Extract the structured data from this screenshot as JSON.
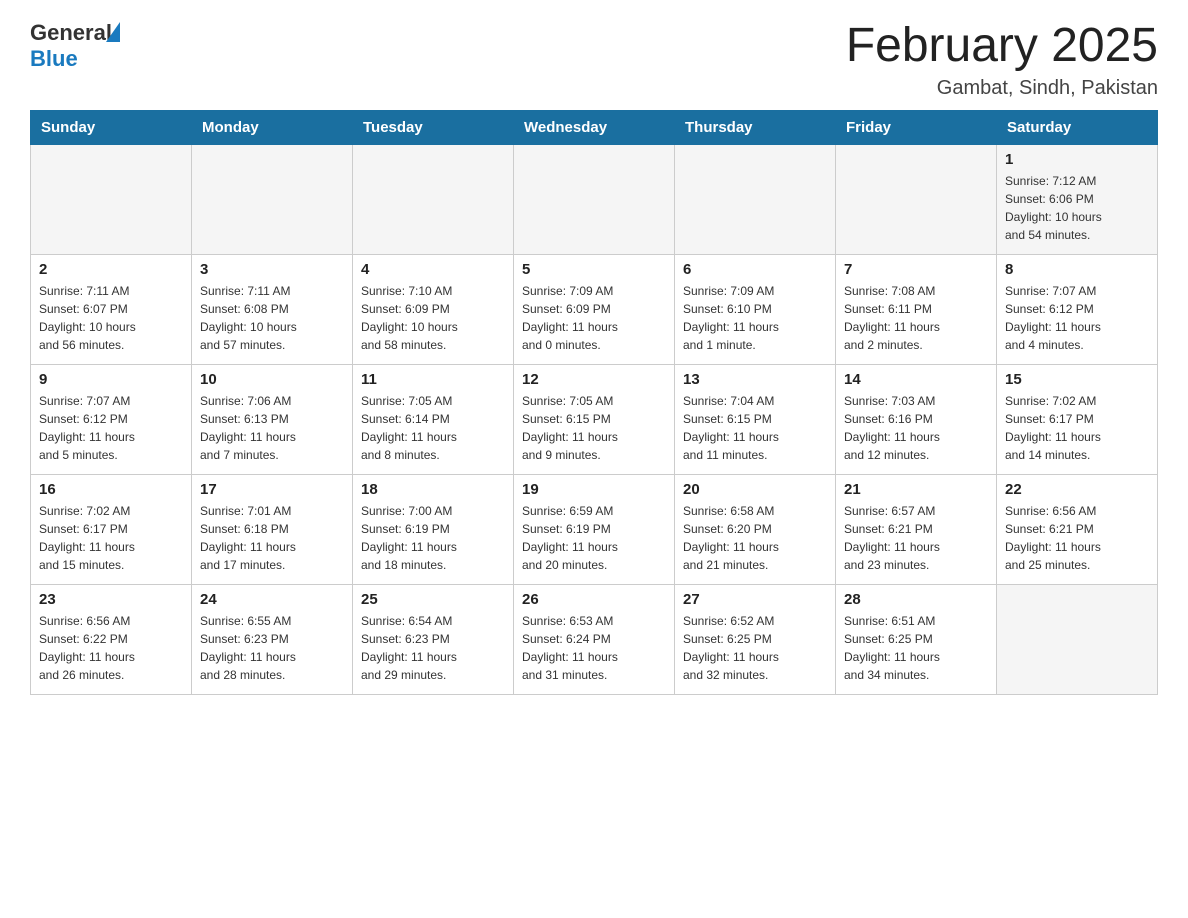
{
  "header": {
    "logo_general": "General",
    "logo_blue": "Blue",
    "month_title": "February 2025",
    "location": "Gambat, Sindh, Pakistan"
  },
  "weekdays": [
    "Sunday",
    "Monday",
    "Tuesday",
    "Wednesday",
    "Thursday",
    "Friday",
    "Saturday"
  ],
  "weeks": [
    [
      {
        "day": "",
        "info": ""
      },
      {
        "day": "",
        "info": ""
      },
      {
        "day": "",
        "info": ""
      },
      {
        "day": "",
        "info": ""
      },
      {
        "day": "",
        "info": ""
      },
      {
        "day": "",
        "info": ""
      },
      {
        "day": "1",
        "info": "Sunrise: 7:12 AM\nSunset: 6:06 PM\nDaylight: 10 hours\nand 54 minutes."
      }
    ],
    [
      {
        "day": "2",
        "info": "Sunrise: 7:11 AM\nSunset: 6:07 PM\nDaylight: 10 hours\nand 56 minutes."
      },
      {
        "day": "3",
        "info": "Sunrise: 7:11 AM\nSunset: 6:08 PM\nDaylight: 10 hours\nand 57 minutes."
      },
      {
        "day": "4",
        "info": "Sunrise: 7:10 AM\nSunset: 6:09 PM\nDaylight: 10 hours\nand 58 minutes."
      },
      {
        "day": "5",
        "info": "Sunrise: 7:09 AM\nSunset: 6:09 PM\nDaylight: 11 hours\nand 0 minutes."
      },
      {
        "day": "6",
        "info": "Sunrise: 7:09 AM\nSunset: 6:10 PM\nDaylight: 11 hours\nand 1 minute."
      },
      {
        "day": "7",
        "info": "Sunrise: 7:08 AM\nSunset: 6:11 PM\nDaylight: 11 hours\nand 2 minutes."
      },
      {
        "day": "8",
        "info": "Sunrise: 7:07 AM\nSunset: 6:12 PM\nDaylight: 11 hours\nand 4 minutes."
      }
    ],
    [
      {
        "day": "9",
        "info": "Sunrise: 7:07 AM\nSunset: 6:12 PM\nDaylight: 11 hours\nand 5 minutes."
      },
      {
        "day": "10",
        "info": "Sunrise: 7:06 AM\nSunset: 6:13 PM\nDaylight: 11 hours\nand 7 minutes."
      },
      {
        "day": "11",
        "info": "Sunrise: 7:05 AM\nSunset: 6:14 PM\nDaylight: 11 hours\nand 8 minutes."
      },
      {
        "day": "12",
        "info": "Sunrise: 7:05 AM\nSunset: 6:15 PM\nDaylight: 11 hours\nand 9 minutes."
      },
      {
        "day": "13",
        "info": "Sunrise: 7:04 AM\nSunset: 6:15 PM\nDaylight: 11 hours\nand 11 minutes."
      },
      {
        "day": "14",
        "info": "Sunrise: 7:03 AM\nSunset: 6:16 PM\nDaylight: 11 hours\nand 12 minutes."
      },
      {
        "day": "15",
        "info": "Sunrise: 7:02 AM\nSunset: 6:17 PM\nDaylight: 11 hours\nand 14 minutes."
      }
    ],
    [
      {
        "day": "16",
        "info": "Sunrise: 7:02 AM\nSunset: 6:17 PM\nDaylight: 11 hours\nand 15 minutes."
      },
      {
        "day": "17",
        "info": "Sunrise: 7:01 AM\nSunset: 6:18 PM\nDaylight: 11 hours\nand 17 minutes."
      },
      {
        "day": "18",
        "info": "Sunrise: 7:00 AM\nSunset: 6:19 PM\nDaylight: 11 hours\nand 18 minutes."
      },
      {
        "day": "19",
        "info": "Sunrise: 6:59 AM\nSunset: 6:19 PM\nDaylight: 11 hours\nand 20 minutes."
      },
      {
        "day": "20",
        "info": "Sunrise: 6:58 AM\nSunset: 6:20 PM\nDaylight: 11 hours\nand 21 minutes."
      },
      {
        "day": "21",
        "info": "Sunrise: 6:57 AM\nSunset: 6:21 PM\nDaylight: 11 hours\nand 23 minutes."
      },
      {
        "day": "22",
        "info": "Sunrise: 6:56 AM\nSunset: 6:21 PM\nDaylight: 11 hours\nand 25 minutes."
      }
    ],
    [
      {
        "day": "23",
        "info": "Sunrise: 6:56 AM\nSunset: 6:22 PM\nDaylight: 11 hours\nand 26 minutes."
      },
      {
        "day": "24",
        "info": "Sunrise: 6:55 AM\nSunset: 6:23 PM\nDaylight: 11 hours\nand 28 minutes."
      },
      {
        "day": "25",
        "info": "Sunrise: 6:54 AM\nSunset: 6:23 PM\nDaylight: 11 hours\nand 29 minutes."
      },
      {
        "day": "26",
        "info": "Sunrise: 6:53 AM\nSunset: 6:24 PM\nDaylight: 11 hours\nand 31 minutes."
      },
      {
        "day": "27",
        "info": "Sunrise: 6:52 AM\nSunset: 6:25 PM\nDaylight: 11 hours\nand 32 minutes."
      },
      {
        "day": "28",
        "info": "Sunrise: 6:51 AM\nSunset: 6:25 PM\nDaylight: 11 hours\nand 34 minutes."
      },
      {
        "day": "",
        "info": ""
      }
    ]
  ]
}
